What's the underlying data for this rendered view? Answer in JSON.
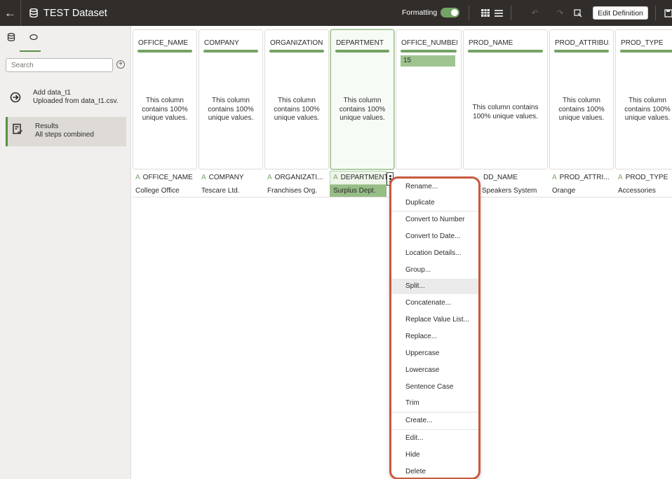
{
  "header": {
    "title": "TEST Dataset",
    "formatting_label": "Formatting",
    "edit_definition": "Edit Definition"
  },
  "left_panel": {
    "search_placeholder": "Search",
    "steps": [
      {
        "title": "Add data_t1",
        "subtitle": "Uploaded from data_t1.csv."
      },
      {
        "title": "Results",
        "subtitle": "All steps combined"
      }
    ]
  },
  "columns": [
    {
      "name": "OFFICE_NAME",
      "msg": "This column contains 100% unique values.",
      "header": "OFFICE_NAME",
      "value": "College Office"
    },
    {
      "name": "COMPANY",
      "msg": "This column contains 100% unique values.",
      "header": "COMPANY",
      "value": "Tescare Ltd."
    },
    {
      "name": "ORGANIZATION",
      "msg": "This column contains 100% unique values.",
      "header": "ORGANIZATI...",
      "value": "Franchises Org."
    },
    {
      "name": "DEPARTMENT",
      "msg": "This column contains 100% unique values.",
      "header": "DEPARTMENT",
      "value": "Surplus Dept."
    },
    {
      "name": "OFFICE_NUMBER",
      "msg": "",
      "header": "",
      "value": "",
      "bar_value": "15"
    },
    {
      "name": "PROD_NAME",
      "msg": "This column contains 100% unique values.",
      "header": "DD_NAME",
      "value": "Speakers System"
    },
    {
      "name": "PROD_ATTRIBU...",
      "msg": "This column contains 100% unique values.",
      "header": "PROD_ATTRI...",
      "value": "Orange"
    },
    {
      "name": "PROD_TYPE",
      "msg": "This column contains 100% unique values.",
      "header": "PROD_TYPE",
      "value": "Accessories"
    }
  ],
  "type_indicator": "A",
  "menu": {
    "items": [
      "Rename...",
      "Duplicate",
      "Convert to Number",
      "Convert to Date...",
      "Location Details...",
      "Group...",
      "Split...",
      "Concatenate...",
      "Replace Value List...",
      "Replace...",
      "Uppercase",
      "Lowercase",
      "Sentence Case",
      "Trim",
      "Create...",
      "Edit...",
      "Hide",
      "Delete"
    ],
    "hovered": "Split..."
  },
  "colors": {
    "header_bg": "#312d2a",
    "accent_green": "#74a365",
    "menu_highlight_border": "#c85a3f"
  }
}
